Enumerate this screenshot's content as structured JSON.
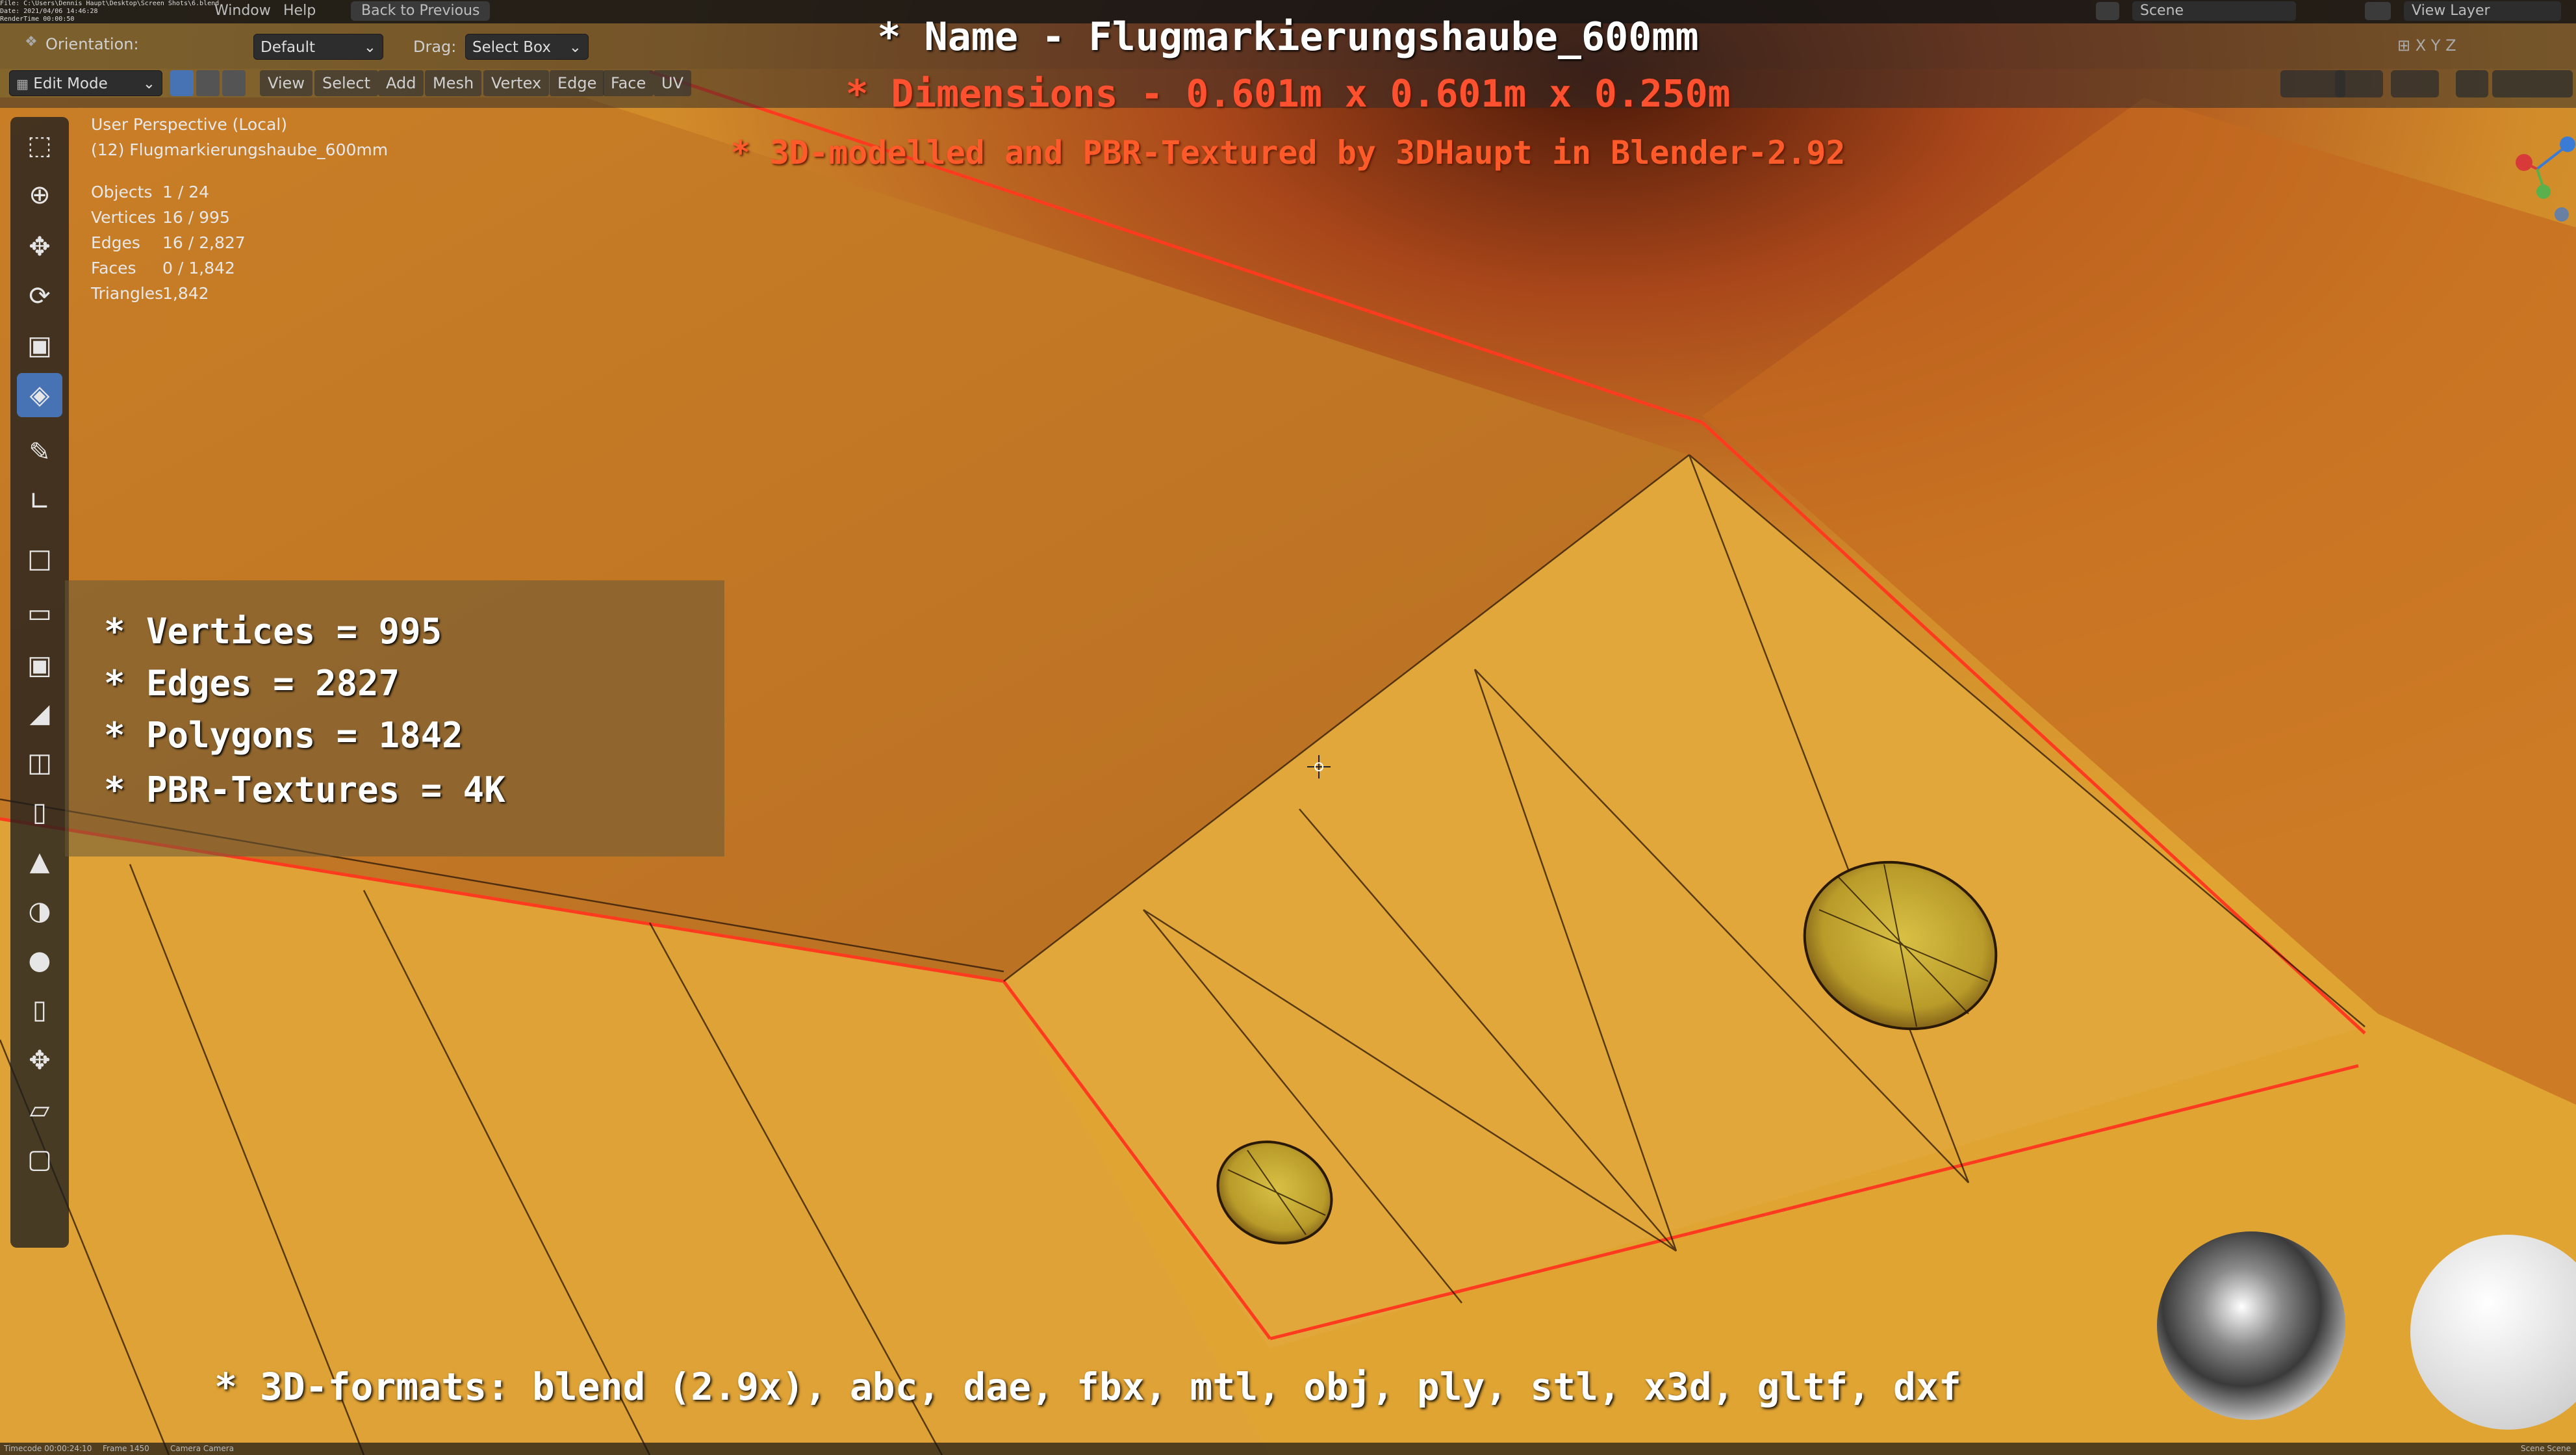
{
  "menubar": {
    "file_path": "File: C:\\Users\\Dennis Haupt\\Desktop\\Screen Shots\\6.blend",
    "date": "Date: 2021/04/06 14:46:28",
    "render_time": "RenderTime 00:00:50",
    "modelled": "Modelled and textured by 3DHaupt in Blender-2.92",
    "menus": [
      "Window",
      "Help"
    ],
    "back_button": "Back to Previous",
    "scene_label": "Scene",
    "view_layer_label": "View Layer"
  },
  "header": {
    "orientation_label": "Orientation:",
    "orientation_value": "Default",
    "drag_label": "Drag:",
    "drag_value": "Select Box",
    "mode": "Edit Mode",
    "menus": [
      "View",
      "Select",
      "Add",
      "Mesh",
      "Vertex",
      "Edge",
      "Face",
      "UV"
    ]
  },
  "viewport": {
    "perspective": "User Perspective (Local)",
    "object_name": "(12) Flugmarkierungshaube_600mm",
    "stats": [
      {
        "label": "Objects",
        "value": "1 / 24"
      },
      {
        "label": "Vertices",
        "value": "16 / 995"
      },
      {
        "label": "Edges",
        "value": "16 / 2,827"
      },
      {
        "label": "Faces",
        "value": "0 / 1,842"
      },
      {
        "label": "Triangles",
        "value": "1,842"
      }
    ]
  },
  "overlay": {
    "name_line": "* Name - Flugmarkierungshaube_600mm",
    "dimensions_line": "* Dimensions -  0.601m x 0.601m x 0.250m",
    "credit_line": "* 3D-modelled and PBR-Textured by 3DHaupt in Blender-2.92",
    "specs": [
      "* Vertices = 995",
      "* Edges = 2827",
      "* Polygons = 1842",
      "* PBR-Textures = 4K"
    ],
    "formats_line": "* 3D-formats: blend (2.9x), abc, dae, fbx, mtl, obj, ply, stl, x3d, gltf, dxf"
  },
  "status": {
    "timecode": "Timecode 00:00:24:10",
    "frame": "Frame 1450",
    "camera": "Camera Camera",
    "scene": "Scene Scene"
  },
  "tools": [
    "select-box-icon",
    "cursor-icon",
    "move-icon",
    "rotate-icon",
    "scale-icon",
    "transform-icon",
    "annotate-icon",
    "measure-icon",
    "add-cube-icon",
    "extrude-icon",
    "inset-icon",
    "bevel-icon",
    "loop-cut-icon",
    "knife-icon",
    "poly-build-icon",
    "spin-icon",
    "smooth-icon",
    "edge-slide-icon",
    "shrink-fatten-icon",
    "shear-icon",
    "rip-icon"
  ],
  "colors": {
    "mesh_orange": "#d9982e",
    "edge_red": "#ff3b1f",
    "overlay_title": "#ffffff",
    "overlay_accent": "#ff5030",
    "active_tool": "#4772b3"
  }
}
